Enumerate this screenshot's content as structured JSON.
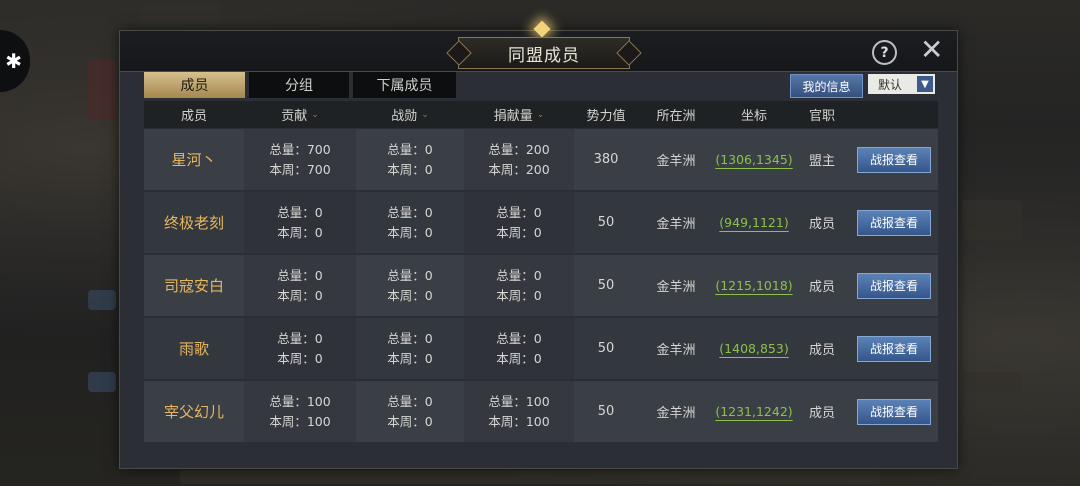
{
  "side_button_icon": "puzzle-icon",
  "window": {
    "title": "同盟成员",
    "help_label": "?",
    "close_label": "✕"
  },
  "tabs": [
    {
      "label": "成员",
      "active": true
    },
    {
      "label": "分组",
      "active": false
    },
    {
      "label": "下属成员",
      "active": false
    }
  ],
  "my_info_label": "我的信息",
  "sort": {
    "selected": "默认",
    "arrow": "▼"
  },
  "columns": [
    "成员",
    "贡献",
    "战勋",
    "捐献量",
    "势力值",
    "所在洲",
    "坐标",
    "官职"
  ],
  "sortable_chevron": "⌄",
  "members": [
    {
      "name": "星河丶",
      "contrib_total": "总量：700",
      "contrib_week": "本周：700",
      "merit_total": "总量：0",
      "merit_week": "本周：0",
      "donate_total": "总量：200",
      "donate_week": "本周：200",
      "power": "380",
      "region": "金羊洲",
      "coord": "(1306,1345)",
      "role": "盟主",
      "button": "战报查看"
    },
    {
      "name": "终极老刻",
      "contrib_total": "总量：0",
      "contrib_week": "本周：0",
      "merit_total": "总量：0",
      "merit_week": "本周：0",
      "donate_total": "总量：0",
      "donate_week": "本周：0",
      "power": "50",
      "region": "金羊洲",
      "coord": "(949,1121)",
      "role": "成员",
      "button": "战报查看"
    },
    {
      "name": "司寇安白",
      "contrib_total": "总量：0",
      "contrib_week": "本周：0",
      "merit_total": "总量：0",
      "merit_week": "本周：0",
      "donate_total": "总量：0",
      "donate_week": "本周：0",
      "power": "50",
      "region": "金羊洲",
      "coord": "(1215,1018)",
      "role": "成员",
      "button": "战报查看"
    },
    {
      "name": "雨歌",
      "contrib_total": "总量：0",
      "contrib_week": "本周：0",
      "merit_total": "总量：0",
      "merit_week": "本周：0",
      "donate_total": "总量：0",
      "donate_week": "本周：0",
      "power": "50",
      "region": "金羊洲",
      "coord": "(1408,853)",
      "role": "成员",
      "button": "战报查看"
    },
    {
      "name": "宰父幻儿",
      "contrib_total": "总量：100",
      "contrib_week": "本周：100",
      "merit_total": "总量：0",
      "merit_week": "本周：0",
      "donate_total": "总量：100",
      "donate_week": "本周：100",
      "power": "50",
      "region": "金羊洲",
      "coord": "(1231,1242)",
      "role": "成员",
      "button": "战报查看"
    }
  ],
  "colors": {
    "accent_gold": "#e7b65e",
    "coord_green": "#8ac24a",
    "button_blue": "#4a6ea3"
  }
}
